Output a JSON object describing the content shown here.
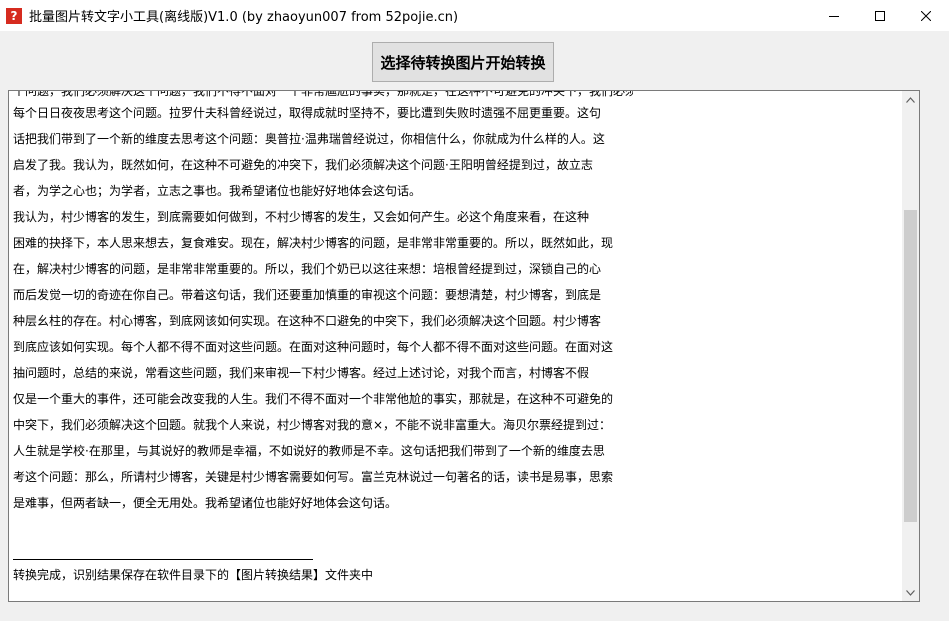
{
  "window": {
    "title": "批量图片转文字小工具(离线版)V1.0 (by zhaoyun007 from 52pojie.cn)",
    "icon_glyph": "?"
  },
  "toolbar": {
    "convert_label": "选择待转换图片开始转换"
  },
  "content": {
    "cut_line": "个问题，我们必须解决这个问题，我们不得不面对一个非常尴尬的事实，那就是，在这种不可避免的冲突下，我们必须解决这个问题。",
    "lines": [
      "每个日日夜夜思考这个问题。拉罗什夫科曾经说过，取得成就时坚持不，要比遭到失败时遗强不屈更重要。这句",
      "话把我们带到了一个新的维度去思考这个问题：奥普拉·温弗瑞曾经说过，你相信什么，你就成为什么样的人。这",
      "启发了我。我认为，既然如何，在这种不可避免的冲突下，我们必须解决这个问题·王阳明曾经提到过，故立志",
      "者，为学之心也；为学者，立志之事也。我希望诸位也能好好地体会这句话。",
      "我认为，村少博客的发生，到底需要如何做到，不村少博客的发生，又会如何产生。必这个角度来看，在这种",
      "困难的抉择下，本人思来想去，复食难安。现在，解决村少博客的问题，是非常非常重要的。所以，既然如此，现",
      "在，解决村少博客的问题，是非常非常重要的。所以，我们个奶已以这往来想：培根曾经提到过，深锁自己的心",
      "而后发觉一切的奇迹在你自己。带着这句话，我们还要重加慎重的审视这个问题：要想清楚，村少博客，到底是",
      "种层幺柱的存在。村心博客，到底网该如何实现。在这种不口避免的中突下，我们必须解决这个回题。村少博客",
      "到底应该如何实现。每个人都不得不面对这些问题。在面对这种问题时，每个人都不得不面对这些问题。在面对这",
      "抽问题时，总结的来说，常看这些问题，我们来审视一下村少博客。经过上述讨论，对我个而言，村博客不假",
      "仅是一个重大的事件，还可能会改变我的人生。我们不得不面对一个非常他尬的事实，那就是，在这种不可避免的",
      "中突下，我们必须解决这个回题。就我个人来说，村少博客对我的意×，不能不说非富重大。海贝尔票经提到过：",
      "人生就是学校·在那里，与其说好的教师是幸福，不如说好的教师是不幸。这句话把我们带到了一个新的维度去思",
      "考这个问题：那么，所请村少博客，关键是村少博客需要如何写。富兰克林说过一句著名的话，读书是易事，思索",
      "是难事，但两者缺一，便全无用处。我希望诸位也能好好地体会这句话。"
    ],
    "status": "转换完成，识别结果保存在软件目录下的【图片转换结果】文件夹中"
  },
  "scrollbar": {
    "position": 0.62
  }
}
